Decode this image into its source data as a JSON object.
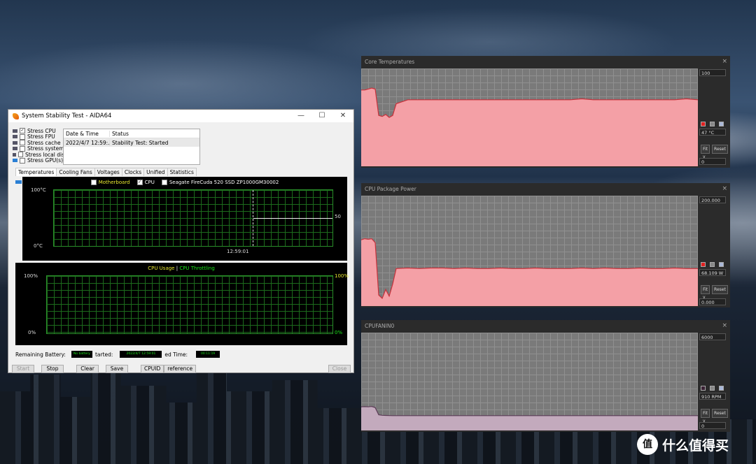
{
  "aida": {
    "title": "System Stability Test - AIDA64",
    "window_controls": {
      "minimize": "—",
      "maximize": "☐",
      "close": "✕"
    },
    "stress_items": [
      {
        "label": "Stress CPU",
        "checked": true,
        "mark": "✓"
      },
      {
        "label": "Stress FPU",
        "checked": false,
        "mark": ""
      },
      {
        "label": "Stress cache",
        "checked": false,
        "mark": ""
      },
      {
        "label": "Stress system",
        "checked": false,
        "mark": ""
      },
      {
        "label": "Stress local dis",
        "checked": false,
        "mark": ""
      },
      {
        "label": "Stress GPU(s)",
        "checked": false,
        "mark": ""
      }
    ],
    "status_table": {
      "headers": [
        "Date & Time",
        "Status"
      ],
      "rows": [
        [
          "2022/4/7 12:59:...",
          "Stability Test: Started"
        ]
      ]
    },
    "tabs": [
      "Temperatures",
      "Cooling Fans",
      "Voltages",
      "Clocks",
      "Unified",
      "Statistics"
    ],
    "temp_graph": {
      "legend": [
        {
          "label": "Motherboard",
          "checked": false,
          "mark": ""
        },
        {
          "label": "CPU",
          "checked": true,
          "mark": "✓"
        },
        {
          "label": "Seagate FireCuda 520 SSD ZP1000GM30002",
          "checked": false,
          "mark": ""
        }
      ],
      "y_top": "100°C",
      "y_bottom": "0°C",
      "time_label": "12:59:01",
      "value_label": "50",
      "cpu_temp": 50
    },
    "usage_graph": {
      "legend_usage": "CPU Usage",
      "legend_sep": "|",
      "legend_throttle": "CPU Throttling",
      "y_top_left": "100%",
      "y_bottom_left": "0%",
      "y_top_right": "100%",
      "y_bottom_right": "0%"
    },
    "footer": {
      "remaining_battery_label": "Remaining Battery:",
      "remaining_battery_value": "No battery",
      "started_label": "tarted:",
      "started_value": "2022/4/7 12:59:01",
      "elapsed_label": "ed Time:",
      "elapsed_value": "00:11:19"
    },
    "buttons": {
      "start": "Start",
      "stop": "Stop",
      "clear": "Clear",
      "save": "Save",
      "cpuid": "CPUID",
      "preferences": "reference",
      "close": "Close"
    }
  },
  "panels": [
    {
      "title": "Core Temperatures",
      "close": "×",
      "max_label": "100",
      "current": "47 °C",
      "min_label": "0",
      "fit_label": "Fit y",
      "reset_label": "Reset",
      "fill_color": "#f4a0a6",
      "line_color": "#c8303a",
      "swatch_color": "#e02020",
      "y_max": 100,
      "series": [
        78,
        78,
        79,
        80,
        79,
        52,
        51,
        53,
        50,
        52,
        64,
        68,
        68,
        68,
        68,
        68,
        68,
        68,
        68,
        68,
        68,
        68,
        68,
        68,
        68,
        68,
        69,
        68,
        68,
        68,
        68,
        68,
        68,
        68,
        68,
        69,
        68
      ]
    },
    {
      "title": "CPU Package Power",
      "close": "×",
      "max_label": "200.000",
      "current": "68.109 W",
      "min_label": "0.000",
      "fit_label": "Fit y",
      "reset_label": "Reset",
      "fill_color": "#f4a0a6",
      "line_color": "#c8303a",
      "swatch_color": "#e02020",
      "y_max": 200,
      "series": [
        120,
        122,
        121,
        122,
        115,
        20,
        14,
        30,
        18,
        40,
        68,
        69,
        68,
        69,
        69,
        68,
        69,
        68,
        68,
        69,
        68,
        68,
        69,
        68,
        68,
        68,
        69,
        68,
        69,
        68,
        68,
        69,
        68,
        68,
        69,
        68,
        68
      ]
    },
    {
      "title": "CPUFANIN0",
      "close": "×",
      "max_label": "6000",
      "current": "910 RPM",
      "min_label": "0",
      "fit_label": "Fit y",
      "reset_label": "Reset",
      "fill_color": "#c3aabd",
      "line_color": "#5a3a55",
      "swatch_color": "#3a2235",
      "y_max": 6000,
      "series": [
        1450,
        1460,
        1450,
        1470,
        1400,
        960,
        930,
        920,
        915,
        910,
        910,
        910,
        910,
        910,
        910,
        910,
        910,
        910,
        910,
        910,
        910,
        910,
        910,
        910,
        910,
        910,
        910,
        910,
        910,
        910,
        910,
        910,
        910,
        910,
        910,
        910,
        910
      ]
    }
  ],
  "watermark": {
    "logo": "值",
    "text": "什么值得买"
  }
}
